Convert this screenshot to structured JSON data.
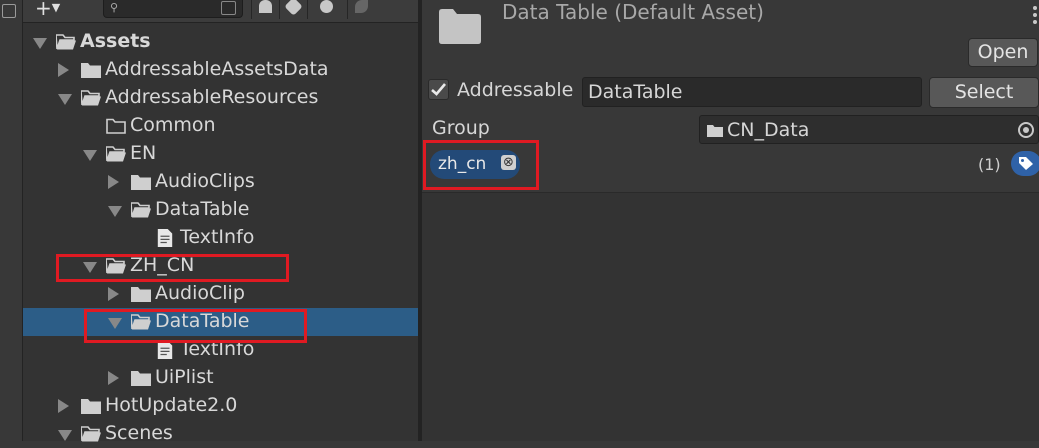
{
  "project": {
    "toolbar": {
      "add_icon": "plus-icon",
      "search": {
        "placeholder": "",
        "icon": "search-icon"
      }
    },
    "tree": [
      {
        "label": "Assets",
        "depth": 0,
        "expanded": true,
        "type": "folder-open",
        "bold": true
      },
      {
        "label": "AddressableAssetsData",
        "depth": 1,
        "expanded": false,
        "type": "folder"
      },
      {
        "label": "AddressableResources",
        "depth": 1,
        "expanded": true,
        "type": "folder-open"
      },
      {
        "label": "Common",
        "depth": 2,
        "expanded": null,
        "type": "folder-empty"
      },
      {
        "label": "EN",
        "depth": 2,
        "expanded": true,
        "type": "folder-open"
      },
      {
        "label": "AudioClips",
        "depth": 3,
        "expanded": false,
        "type": "folder"
      },
      {
        "label": "DataTable",
        "depth": 3,
        "expanded": true,
        "type": "folder-open"
      },
      {
        "label": "TextInfo",
        "depth": 4,
        "expanded": null,
        "type": "file"
      },
      {
        "label": "ZH_CN",
        "depth": 2,
        "expanded": true,
        "type": "folder-open",
        "highlight": true
      },
      {
        "label": "AudioClip",
        "depth": 3,
        "expanded": false,
        "type": "folder"
      },
      {
        "label": "DataTable",
        "depth": 3,
        "expanded": true,
        "type": "folder-open",
        "selected": true,
        "highlight": true
      },
      {
        "label": "TextInfo",
        "depth": 4,
        "expanded": null,
        "type": "file"
      },
      {
        "label": "UiPlist",
        "depth": 3,
        "expanded": false,
        "type": "folder"
      },
      {
        "label": "HotUpdate2.0",
        "depth": 1,
        "expanded": false,
        "type": "folder"
      },
      {
        "label": "Scenes",
        "depth": 1,
        "expanded": true,
        "type": "folder-open"
      }
    ]
  },
  "inspector": {
    "title": "Data Table (Default Asset)",
    "open_label": "Open",
    "addressable": {
      "checked": true,
      "label": "Addressable",
      "address": "DataTable",
      "select_label": "Select"
    },
    "group": {
      "label": "Group",
      "value": "CN_Data"
    },
    "labels": {
      "tags": [
        "zh_cn"
      ],
      "count": "(1)"
    }
  },
  "colors": {
    "selection": "#2c5d87",
    "highlight": "#e01a22",
    "tag_chip": "#234a78",
    "tag_button": "#2f62a8"
  }
}
